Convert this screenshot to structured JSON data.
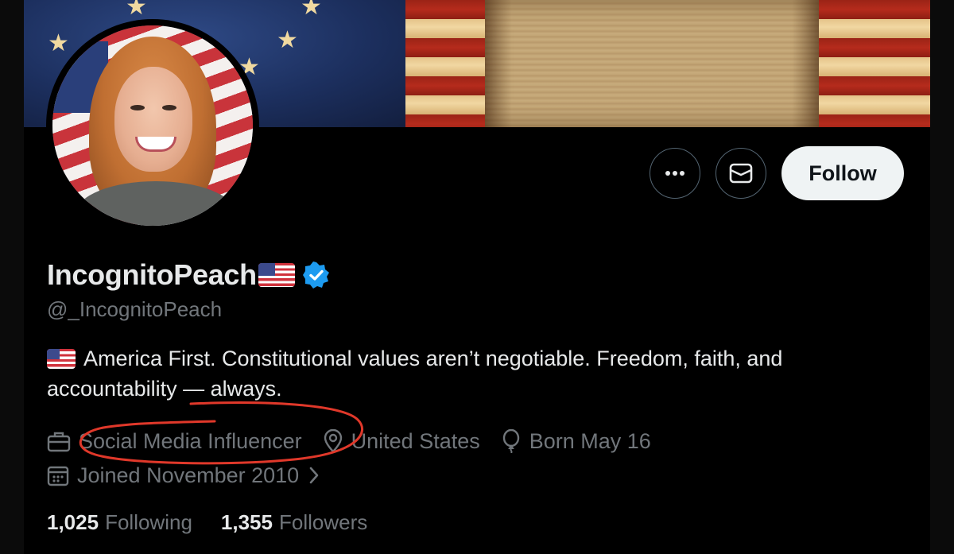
{
  "profile": {
    "display_name": "IncognitoPeach",
    "name_emoji": "us-flag-emoji",
    "verified": true,
    "handle": "@_IncognitoPeach",
    "bio_line1": "America First. Constitutional values aren’t negotiable. Freedom, faith, and",
    "bio_line2": "accountability — always.",
    "bio_emoji": "us-flag-emoji",
    "profession": "Social Media Influencer",
    "location": "United States",
    "birthday": "Born May 16",
    "joined": "Joined November 2010"
  },
  "actions": {
    "more_icon": "ellipsis-icon",
    "message_icon": "envelope-icon",
    "follow_label": "Follow"
  },
  "stats": {
    "following_count": "1,025",
    "following_label": "Following",
    "followers_count": "1,355",
    "followers_label": "Followers"
  },
  "colors": {
    "background": "#000000",
    "text_primary": "#e7e9ea",
    "text_secondary": "#71767b",
    "verified_blue": "#1d9bf0",
    "follow_button_bg": "#eff3f4",
    "annotation_red": "#e0382a"
  }
}
